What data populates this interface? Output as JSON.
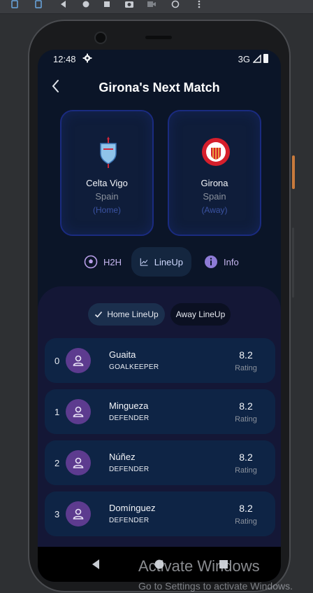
{
  "status_bar": {
    "time": "12:48",
    "network": "3G"
  },
  "header": {
    "title": "Girona's Next Match"
  },
  "teams": [
    {
      "name": "Celta Vigo",
      "country": "Spain",
      "role": "(Home)"
    },
    {
      "name": "Girona",
      "country": "Spain",
      "role": "(Away)"
    }
  ],
  "tabs": [
    {
      "label": "H2H",
      "icon": "soccer-ball-icon"
    },
    {
      "label": "LineUp",
      "icon": "chart-line-icon"
    },
    {
      "label": "Info",
      "icon": "info-icon"
    }
  ],
  "active_tab": "LineUp",
  "lineup_toggle": {
    "home_label": "Home LineUp",
    "away_label": "Away LineUp",
    "selected": "Home LineUp"
  },
  "players": [
    {
      "index": "0",
      "name": "Guaita",
      "position": "GOALKEEPER",
      "rating": "8.2",
      "rating_label": "Rating"
    },
    {
      "index": "1",
      "name": "Mingueza",
      "position": "DEFENDER",
      "rating": "8.2",
      "rating_label": "Rating"
    },
    {
      "index": "2",
      "name": "Núñez",
      "position": "DEFENDER",
      "rating": "8.2",
      "rating_label": "Rating"
    },
    {
      "index": "3",
      "name": "Domínguez",
      "position": "DEFENDER",
      "rating": "8.2",
      "rating_label": "Rating"
    }
  ],
  "watermark": {
    "title": "Activate Windows",
    "subtitle": "Go to Settings to activate Windows."
  },
  "colors": {
    "background": "#0b1528",
    "card": "#0e2445",
    "accent": "#5d3b8f",
    "tab_text": "#c6b6f0"
  }
}
